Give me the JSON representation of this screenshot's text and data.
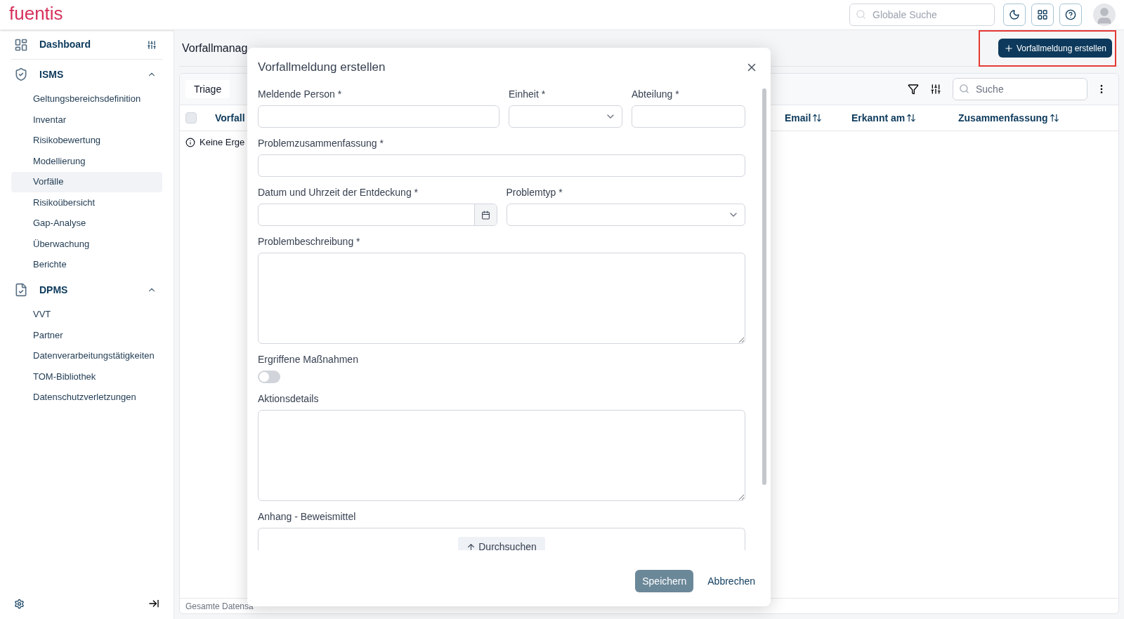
{
  "header": {
    "logo": "fuentis",
    "search": {
      "placeholder": "Globale Suche"
    }
  },
  "sidebar": {
    "dashboard": "Dashboard",
    "sections": [
      {
        "title": "ISMS",
        "expanded": true,
        "items": [
          {
            "label": "Geltungsbereichsdefinition",
            "selected": false
          },
          {
            "label": "Inventar",
            "selected": false
          },
          {
            "label": "Risikobewertung",
            "selected": false
          },
          {
            "label": "Modellierung",
            "selected": false
          },
          {
            "label": "Vorfälle",
            "selected": true
          },
          {
            "label": "Risikoübersicht",
            "selected": false
          },
          {
            "label": "Gap-Analyse",
            "selected": false
          },
          {
            "label": "Überwachung",
            "selected": false
          },
          {
            "label": "Berichte",
            "selected": false
          }
        ]
      },
      {
        "title": "DPMS",
        "expanded": true,
        "items": [
          {
            "label": "VVT",
            "selected": false
          },
          {
            "label": "Partner",
            "selected": false
          },
          {
            "label": "Datenverarbeitungstätigkeiten",
            "selected": false
          },
          {
            "label": "TOM-Bibliothek",
            "selected": false
          },
          {
            "label": "Datenschutzverletzungen",
            "selected": false
          }
        ]
      }
    ]
  },
  "page": {
    "title": "Vorfallmanag",
    "create_button": "Vorfallmeldung erstellen",
    "create_button_highlighted": true
  },
  "table": {
    "select_all_checked": false,
    "tabs": [
      {
        "label": "Triage",
        "selected": true
      }
    ],
    "search": {
      "placeholder": "Suche"
    },
    "columns": [
      {
        "label": "Vorfall"
      },
      {
        "label": "Email",
        "sortable": true
      },
      {
        "label": "Erkannt am",
        "sortable": true
      },
      {
        "label": "Zusammenfassung",
        "sortable": true
      }
    ],
    "empty_message": "Keine Erge",
    "footer": "Gesamte Datensa"
  },
  "dialog": {
    "title": "Vorfallmeldung erstellen",
    "rows": [
      [
        {
          "kind": "text",
          "label": "Meldende Person *"
        },
        {
          "kind": "select",
          "label": "Einheit *"
        },
        {
          "kind": "text",
          "label": "Abteilung *"
        }
      ],
      [
        {
          "kind": "text",
          "label": "Problemzusammenfassung *"
        }
      ],
      [
        {
          "kind": "date",
          "label": "Datum und Uhrzeit der Entdeckung *"
        },
        {
          "kind": "select",
          "label": "Problemtyp *"
        }
      ],
      [
        {
          "kind": "textarea",
          "label": "Problembeschreibung *"
        }
      ],
      [
        {
          "kind": "toggle",
          "label": "Ergriffene Maßnahmen",
          "on": false
        }
      ],
      [
        {
          "kind": "textarea",
          "label": "Aktionsdetails"
        }
      ],
      [
        {
          "kind": "upload",
          "label": "Anhang - Beweismittel",
          "button": "Durchsuchen"
        }
      ]
    ],
    "buttons": [
      {
        "label": "Speichern",
        "kind": "primary"
      },
      {
        "label": "Abbrechen",
        "kind": "text"
      }
    ]
  }
}
